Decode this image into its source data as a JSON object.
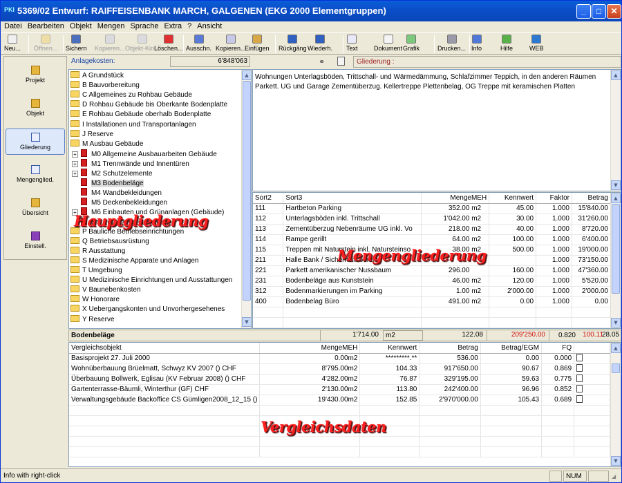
{
  "window": {
    "title": "5369/02 Entwurf: RAIFFEISENBANK MARCH, GALGENEN (EKG 2000 Elementgruppen)",
    "app_icon": "PKI"
  },
  "menu": [
    "Datei",
    "Bearbeiten",
    "Objekt",
    "Mengen",
    "Sprache",
    "Extra",
    "?",
    "Ansicht"
  ],
  "toolbar": [
    {
      "label": "Neu...",
      "icon": "new-icon",
      "enabled": true
    },
    {
      "label": "Öffnen...",
      "icon": "open-icon",
      "enabled": false
    },
    {
      "label": "Sichern",
      "icon": "save-icon",
      "enabled": true
    },
    {
      "label": "Kopieren...",
      "icon": "copy-icon",
      "enabled": false
    },
    {
      "label": "Objekt-Kin...",
      "icon": "object-icon",
      "enabled": false
    },
    {
      "label": "Löschen...",
      "icon": "delete-icon",
      "enabled": true
    },
    {
      "label": "Ausschn.",
      "icon": "cut-icon",
      "enabled": true
    },
    {
      "label": "Kopieren...",
      "icon": "copy-icon",
      "enabled": true
    },
    {
      "label": "Einfügen",
      "icon": "paste-icon",
      "enabled": true
    },
    {
      "label": "Rückgäng",
      "icon": "undo-icon",
      "enabled": true
    },
    {
      "label": "Wiederh.",
      "icon": "redo-icon",
      "enabled": true
    },
    {
      "label": "Text",
      "icon": "text-icon",
      "enabled": true
    },
    {
      "label": "Dokument",
      "icon": "document-icon",
      "enabled": true
    },
    {
      "label": "Grafik",
      "icon": "graphic-icon",
      "enabled": true
    },
    {
      "label": "Drucken...",
      "icon": "print-icon",
      "enabled": true
    },
    {
      "label": "Info",
      "icon": "info-icon",
      "enabled": true
    },
    {
      "label": "Hilfe",
      "icon": "help-icon",
      "enabled": true
    },
    {
      "label": "WEB",
      "icon": "web-icon",
      "enabled": true
    }
  ],
  "nav": [
    {
      "label": "Projekt",
      "selected": false
    },
    {
      "label": "Objekt",
      "selected": false
    },
    {
      "label": "Gliederung",
      "selected": true
    },
    {
      "label": "Mengenglied.",
      "selected": false
    },
    {
      "label": "Übersicht",
      "selected": false
    },
    {
      "label": "Einstell.",
      "selected": false
    }
  ],
  "anlagekosten": {
    "label": "Anlagekosten:",
    "value": "6'848'063"
  },
  "gliederung_label": "Gliederung :",
  "tree": [
    {
      "text": "A Grundstück",
      "type": "folder",
      "level": 0
    },
    {
      "text": "B Bauvorbereitung",
      "type": "folder",
      "level": 0
    },
    {
      "text": "C Allgemeines zu Rohbau Gebäude",
      "type": "folder",
      "level": 0
    },
    {
      "text": "D Rohbau Gebäude bis Oberkante Bodenplatte",
      "type": "folder",
      "level": 0
    },
    {
      "text": "E Rohbau Gebäude oberhalb Bodenplatte",
      "type": "folder",
      "level": 0
    },
    {
      "text": "I Installationen und Transportanlagen",
      "type": "folder",
      "level": 0
    },
    {
      "text": "J Reserve",
      "type": "folder",
      "level": 0
    },
    {
      "text": "M Ausbau Gebäude",
      "type": "folder",
      "level": 0
    },
    {
      "text": "M0 Allgemeine Ausbauarbeiten Gebäude",
      "type": "book",
      "level": 1,
      "expander": true
    },
    {
      "text": "M1 Trennwände und Innentüren",
      "type": "book",
      "level": 1,
      "expander": true
    },
    {
      "text": "M2 Schutzelemente",
      "type": "book",
      "level": 1,
      "expander": true
    },
    {
      "text": "M3 Bodenbeläge",
      "type": "book",
      "level": 1,
      "expander": false,
      "selected": true
    },
    {
      "text": "M4 Wandbekleidungen",
      "type": "book",
      "level": 1,
      "expander": false
    },
    {
      "text": "M5 Deckenbekleidungen",
      "type": "book",
      "level": 1,
      "expander": false
    },
    {
      "text": "M6 Einbauten und Grünanlagen (Gebäude)",
      "type": "book",
      "level": 1,
      "expander": true
    },
    {
      "text": "M8 Ergänzende Leistungen",
      "type": "book",
      "level": 1,
      "expander": false
    },
    {
      "text": "P Bauliche Betriebseinrichtungen",
      "type": "folder",
      "level": 0
    },
    {
      "text": "Q Betriebsausrüstung",
      "type": "folder",
      "level": 0
    },
    {
      "text": "R Ausstattung",
      "type": "folder",
      "level": 0
    },
    {
      "text": "S Medizinische Apparate und Anlagen",
      "type": "folder",
      "level": 0
    },
    {
      "text": "T Umgebung",
      "type": "folder",
      "level": 0
    },
    {
      "text": "U Medizinische Einrichtungen und Ausstattungen",
      "type": "folder",
      "level": 0
    },
    {
      "text": "V Baunebenkosten",
      "type": "folder",
      "level": 0
    },
    {
      "text": "W Honorare",
      "type": "folder",
      "level": 0
    },
    {
      "text": "X Uebergangskonten und Unvorhergesehenes",
      "type": "folder",
      "level": 0
    },
    {
      "text": "Y Reserve",
      "type": "folder",
      "level": 0
    }
  ],
  "description": "Wohnungen Unterlagsböden, Trittschall- und Wärmedämmung, Schlafzimmer Teppich, in den anderen Räumen Parkett. UG und Garage Zementüberzug. Kellertreppe Plettenbelag, OG Treppe mit keramischen Platten",
  "mengen": {
    "headers": [
      "Sort2",
      "Sort3",
      "MengeMEH",
      "Kennwert",
      "Faktor",
      "Betrag"
    ],
    "rows": [
      [
        "111",
        "Hartbeton Parking",
        "352.00",
        "m2",
        "45.00",
        "1.000",
        "15'840.00"
      ],
      [
        "112",
        "Unterlagsböden inkl. Trittschall",
        "1'042.00",
        "m2",
        "30.00",
        "1.000",
        "31'260.00"
      ],
      [
        "113",
        "Zementüberzug Nebenräume UG inkl. Vo",
        "218.00",
        "m2",
        "40.00",
        "1.000",
        "8'720.00"
      ],
      [
        "114",
        "Rampe gerillt",
        "64.00",
        "m2",
        "100.00",
        "1.000",
        "6'400.00"
      ],
      [
        "115",
        "Treppen mit Naturstein inkl. Natursteinso",
        "38.00",
        "m2",
        "500.00",
        "1.000",
        "19'000.00"
      ],
      [
        "211",
        "Halle Bank / Sicherheitsbereich",
        "",
        "",
        "",
        "1.000",
        "73'150.00"
      ],
      [
        "221",
        "Parkett amerikanischer Nussbaum",
        "296.00",
        "",
        "160.00",
        "1.000",
        "47'360.00"
      ],
      [
        "231",
        "Bodenbeläge aus Kunststein",
        "46.00",
        "m2",
        "120.00",
        "1.000",
        "5'520.00"
      ],
      [
        "312",
        "Bodenmarkierungen im Parking",
        "1.00",
        "m2",
        "2'000.00",
        "1.000",
        "2'000.00"
      ],
      [
        "400",
        "Bodenbelag Büro",
        "491.00",
        "m2",
        "0.00",
        "1.000",
        "0.00"
      ]
    ]
  },
  "summary": {
    "name": "Bodenbeläge",
    "menge": "1'714.00",
    "meh": "m2",
    "kennwert": "122.08",
    "betrag": "209'250.00",
    "betrag_egm": "100.11",
    "fq": "0.820",
    "extra": "28.05"
  },
  "vergleich": {
    "headers": [
      "Vergleichsobjekt",
      "MengeMEH",
      "Kennwert",
      "Betrag",
      "Betrag/EGM",
      "FQ"
    ],
    "rows": [
      [
        "Basisprojekt 27. Juli 2000",
        "0.00m2",
        "*********.**",
        "536.00",
        "0.00",
        "0.000"
      ],
      [
        "Wohnüberbauung Brüelmatt, Schwyz KV 2007 () CHF",
        "8'795.00m2",
        "104.33",
        "917'650.00",
        "90.67",
        "0.869"
      ],
      [
        "Überbauung Bollwerk, Eglisau (KV Februar 2008) () CHF",
        "4'282.00m2",
        "76.87",
        "329'195.00",
        "59.63",
        "0.775"
      ],
      [
        "Gartenterrasse-Bäumli, Winterthur (GF) CHF",
        "2'130.00m2",
        "113.80",
        "242'400.00",
        "96.96",
        "0.852"
      ],
      [
        "Verwaltungsgebäude Backoffice CS Gümligen2008_12_15 ()",
        "19'430.00m2",
        "152.85",
        "2'970'000.00",
        "105.43",
        "0.689"
      ]
    ]
  },
  "overlays": {
    "haupt": "Hauptgliederung",
    "mengen": "Mengengliederung",
    "vergleich": "Vergleichsdaten"
  },
  "status": {
    "text": "Info with right-click",
    "num": "NUM"
  }
}
